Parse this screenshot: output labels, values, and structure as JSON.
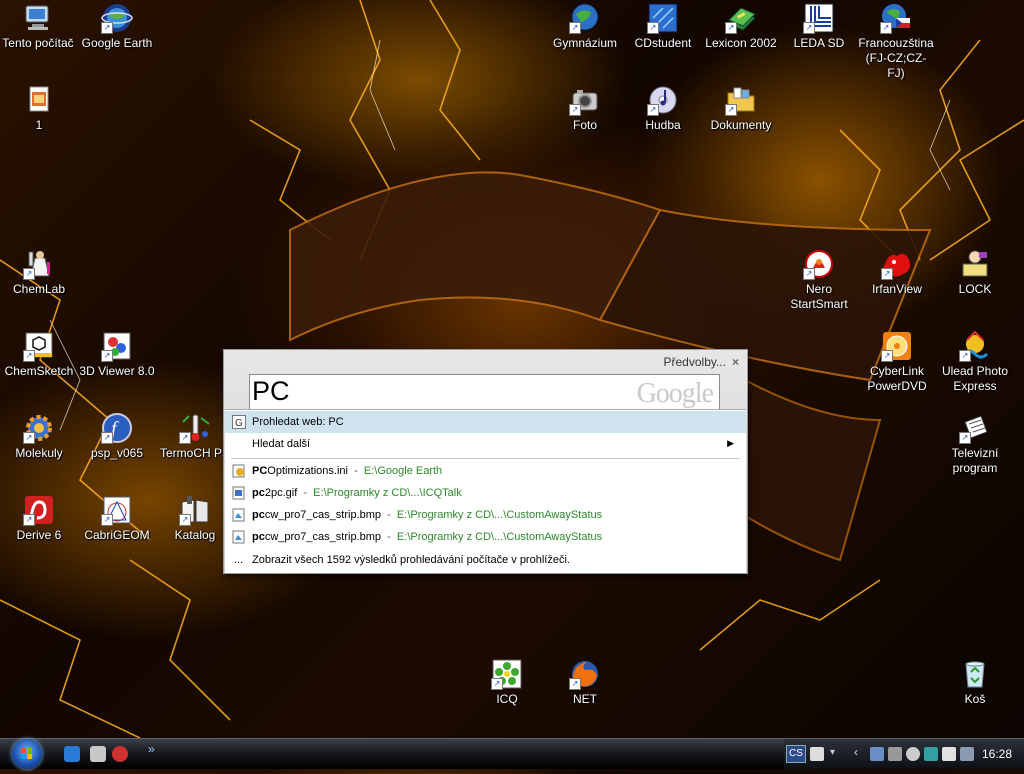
{
  "desktop_icons": [
    {
      "label": "Tento počítač",
      "icon": "computer-icon"
    },
    {
      "label": "Google Earth",
      "icon": "google-earth-icon"
    },
    {
      "label": "1",
      "icon": "file-icon"
    },
    {
      "label": "Gymnázium",
      "icon": "globe-icon"
    },
    {
      "label": "CDstudent",
      "icon": "cdstudent-icon"
    },
    {
      "label": "Lexicon 2002",
      "icon": "book-icon"
    },
    {
      "label": "LEDA SD",
      "icon": "leda-icon"
    },
    {
      "label": "Francouzština\n(FJ-CZ;CZ-FJ)",
      "icon": "flag-globe-icon"
    },
    {
      "label": "Foto",
      "icon": "camera-icon"
    },
    {
      "label": "Hudba",
      "icon": "music-disc-icon"
    },
    {
      "label": "Dokumenty",
      "icon": "folder-icon"
    },
    {
      "label": "ChemLab",
      "icon": "chemlab-icon"
    },
    {
      "label": "Nero\nStartSmart",
      "icon": "nero-icon"
    },
    {
      "label": "IrfanView",
      "icon": "irfanview-icon"
    },
    {
      "label": "LOCK",
      "icon": "lock-icon"
    },
    {
      "label": "ChemSketch",
      "icon": "chemsketch-icon"
    },
    {
      "label": "3D Viewer 8.0",
      "icon": "molecule-viewer-icon"
    },
    {
      "label": "CyberLink\nPowerDVD",
      "icon": "dvd-icon"
    },
    {
      "label": "Ulead Photo\nExpress",
      "icon": "ulead-icon"
    },
    {
      "label": "Molekuly",
      "icon": "gear-molecule-icon"
    },
    {
      "label": "psp_v065",
      "icon": "flash-icon"
    },
    {
      "label": "TermoCH PS",
      "icon": "thermo-icon"
    },
    {
      "label": "Televizní\nprogram",
      "icon": "tv-program-icon"
    },
    {
      "label": "Derive 6",
      "icon": "derive-icon"
    },
    {
      "label": "CabriGEOM",
      "icon": "cabri-icon"
    },
    {
      "label": "Katalog",
      "icon": "catalog-book-icon"
    },
    {
      "label": "ICQ",
      "icon": "icq-flower-icon"
    },
    {
      "label": "NET",
      "icon": "firefox-icon"
    },
    {
      "label": "Koš",
      "icon": "recycle-bin-icon"
    }
  ],
  "search_dialog": {
    "options_label": "Předvolby...",
    "close_glyph": "×",
    "query": "PC",
    "logo_text": "Google",
    "search_web_label": "Prohledat web: PC",
    "search_more_label": "Hledat další",
    "results": [
      {
        "name_bold": "PC",
        "name_rest": "Optimizations.ini",
        "path": "E:\\Google Earth",
        "icon": "ini-file-icon"
      },
      {
        "name_bold": "pc",
        "name_rest": "2pc.gif",
        "path": "E:\\Programky z CD\\...\\ICQTalk",
        "icon": "gif-file-icon"
      },
      {
        "name_bold": "pc",
        "name_rest": "cw_pro7_cas_strip.bmp",
        "path": "E:\\Programky z CD\\...\\CustomAwayStatus",
        "icon": "bmp-file-icon"
      },
      {
        "name_bold": "pc",
        "name_rest": "cw_pro7_cas_strip.bmp",
        "path": "E:\\Programky z CD\\...\\CustomAwayStatus",
        "icon": "bmp-file-icon"
      }
    ],
    "show_all_label": "Zobrazit všech 1592 výsledků prohledávání počítače v prohlížeči.",
    "ellipsis": "..."
  },
  "taskbar": {
    "quicklaunch_overflow": "»",
    "language": "CS",
    "clock": "16:28"
  }
}
